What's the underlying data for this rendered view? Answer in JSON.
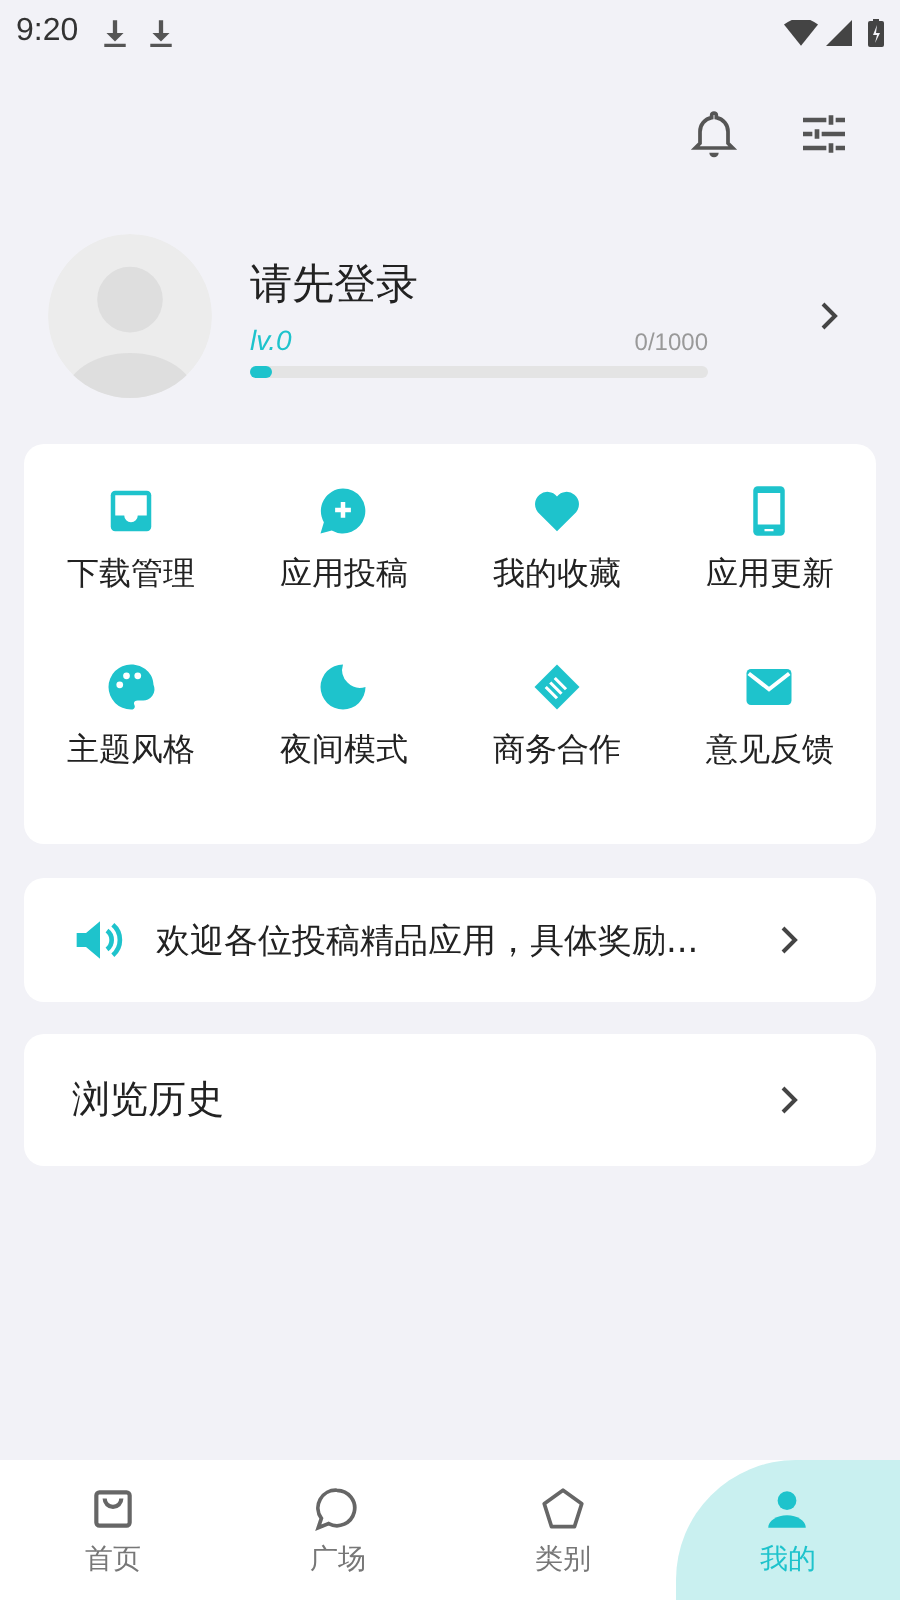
{
  "status_bar": {
    "time": "9:20"
  },
  "profile": {
    "name": "请先登录",
    "level_label": "lv.0",
    "points": "0/1000",
    "level": 0.05
  },
  "menu": [
    {
      "label": "下载管理"
    },
    {
      "label": "应用投稿"
    },
    {
      "label": "我的收藏"
    },
    {
      "label": "应用更新"
    },
    {
      "label": "主题风格"
    },
    {
      "label": "夜间模式"
    },
    {
      "label": "商务合作"
    },
    {
      "label": "意见反馈"
    }
  ],
  "notice": {
    "text": "欢迎各位投稿精品应用，具体奖励..."
  },
  "history": {
    "label": "浏览历史"
  },
  "tabs": [
    {
      "label": "首页",
      "selected": false
    },
    {
      "label": "广场",
      "selected": false
    },
    {
      "label": "类别",
      "selected": false
    },
    {
      "label": "我的",
      "selected": true
    }
  ]
}
